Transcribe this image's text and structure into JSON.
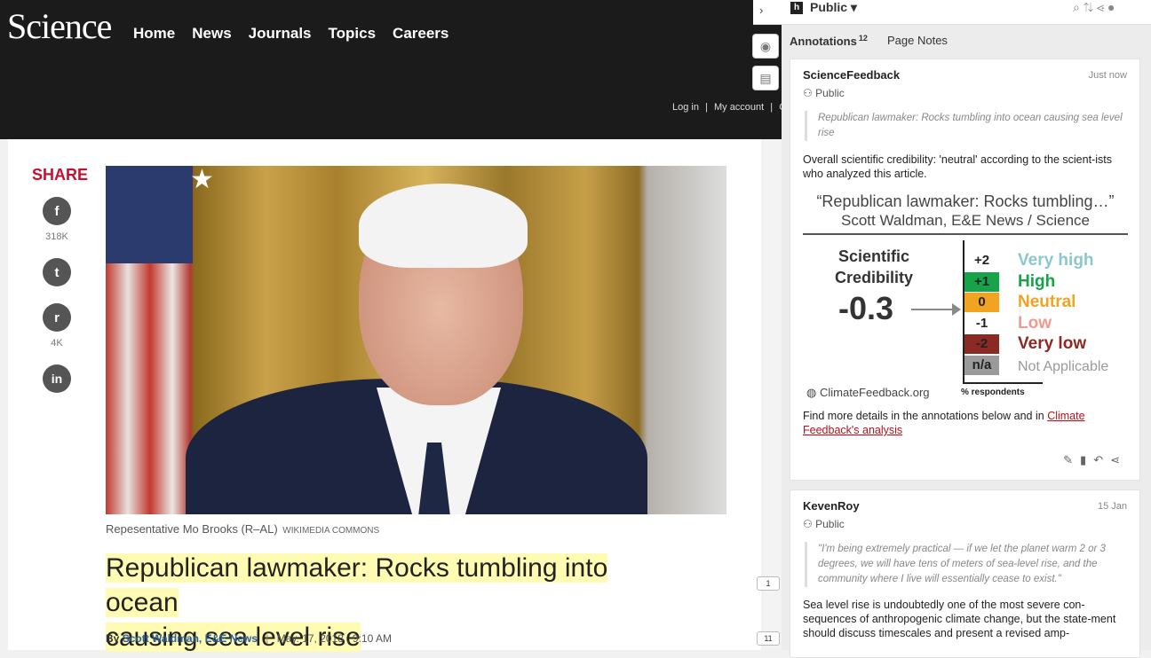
{
  "site": {
    "logo": "Science",
    "nav": [
      "Home",
      "News",
      "Journals",
      "Topics",
      "Careers"
    ],
    "account": [
      "Log in",
      "|",
      "My account",
      "|",
      "Co"
    ]
  },
  "share": {
    "title": "SHARE",
    "facebook_icon": "f",
    "facebook_count": "318K",
    "twitter_icon": "t",
    "reddit_icon": "r",
    "reddit_count": "4K",
    "linkedin_icon": "in"
  },
  "article": {
    "caption": "Repesentative Mo Brooks (R–AL)",
    "caption_credit": "Wikimedia Commons",
    "headline_line1": "Republican lawmaker: Rocks tumbling into ocean",
    "headline_line2": "causing sea level rise",
    "by": "By",
    "author": "Scott Waldman, E&E News",
    "date": "May. 17, 2018 , 9:10 AM"
  },
  "buckets": [
    "1",
    "11"
  ],
  "hypothesis": {
    "group": "Public ▾",
    "tab_annotations": "Annotations",
    "tab_annotations_count": "12",
    "tab_page_notes": "Page Notes",
    "annotations": [
      {
        "user": "ScienceFeedback",
        "time": "Just now",
        "group": "Public",
        "quote": "Republican lawmaker: Rocks tumbling into ocean causing sea level rise",
        "text": "Overall scientific credibility: 'neutral' according to the scient-ists who analyzed this article.",
        "more_text": "Find more details in the annotations below and in",
        "link": "Climate Feedback's analysis"
      },
      {
        "user": "KevenRoy",
        "time": "15 Jan",
        "group": "Public",
        "quote": "\"I'm being extremely practical — if we let the planet warm 2 or 3 degrees, we will have tens of meters of sea-level rise, and the community where I live will essentially cease to exist.\"",
        "text": "Sea level rise is undoubtedly one of the most severe con-sequences of anthropogenic climate change, but the state-ment should discuss timescales and present a revised amp-"
      }
    ],
    "credibility": {
      "title1": "“Republican lawmaker: Rocks tumbling…”",
      "title2": "Scott Waldman, E&E News / Science",
      "label": "Scientific Credibility",
      "score": "-0.3",
      "levels": [
        {
          "value": "+2",
          "name": "Very high",
          "color": "#8cc7cf",
          "bg": "#ffffff",
          "fg": "#222222"
        },
        {
          "value": "+1",
          "name": "High",
          "color": "#16a34a",
          "bg": "#16a34a",
          "fg": "#222222"
        },
        {
          "value": "0",
          "name": "Neutral",
          "color": "#f2a322",
          "bg": "#f2a322",
          "fg": "#222222"
        },
        {
          "value": "-1",
          "name": "Low",
          "color": "#f29a8f",
          "bg": "#ffffff",
          "fg": "#222222"
        },
        {
          "value": "-2",
          "name": "Very low",
          "color": "#8a2a22",
          "bg": "#8a2a22",
          "fg": "#222222"
        },
        {
          "value": "n/a",
          "name": "Not Applicable",
          "color": "#9a9a9a",
          "bg": "#9a9a9a",
          "fg": "#222222"
        }
      ],
      "site": "ClimateFeedback.org",
      "axis_label": "% respondents"
    }
  }
}
